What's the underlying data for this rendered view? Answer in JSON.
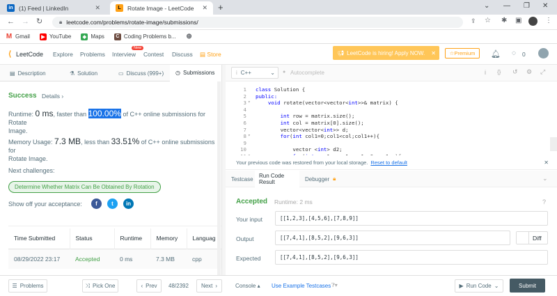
{
  "browser": {
    "tabs": [
      {
        "title": "(1) Feed | LinkedIn",
        "favicon": "in"
      },
      {
        "title": "Rotate Image - LeetCode",
        "favicon": "L"
      }
    ],
    "url": "leetcode.com/problems/rotate-image/submissions/",
    "bookmarks": [
      "Gmail",
      "YouTube",
      "Maps",
      "Coding Problems b..."
    ]
  },
  "nav": {
    "logo": "LeetCode",
    "links": [
      "Explore",
      "Problems",
      "Interview",
      "Contest",
      "Discuss",
      "Store"
    ],
    "new_badge": "New",
    "banner": "LeetCode is hiring! Apply NOW.",
    "premium": "Premium",
    "coins": "0"
  },
  "left_tabs": [
    "Description",
    "Solution",
    "Discuss (999+)",
    "Submissions"
  ],
  "result": {
    "status": "Success",
    "details": "Details",
    "runtime_label": "Runtime:",
    "runtime_value": "0 ms",
    "runtime_faster": ", faster than ",
    "runtime_pct": "100.00%",
    "runtime_rest": " of C++ online submissions for Rotate",
    "runtime_rest2": "Image.",
    "memory_label": "Memory Usage:",
    "memory_value": "7.3 MB",
    "memory_less": ", less than ",
    "memory_pct": "33.51%",
    "memory_rest": " of C++ online submissions for",
    "memory_rest2": "Rotate Image.",
    "next_label": "Next challenges:",
    "next_challenge": "Determine Whether Matrix Can Be Obtained By Rotation",
    "share_label": "Show off your acceptance:"
  },
  "submissions": {
    "headers": [
      "Time Submitted",
      "Status",
      "Runtime",
      "Memory",
      "Languag"
    ],
    "rows": [
      {
        "time": "08/29/2022 23:17",
        "status": "Accepted",
        "runtime": "0 ms",
        "memory": "7.3 MB",
        "lang": "cpp"
      }
    ]
  },
  "editor": {
    "language": "C++",
    "autocomplete": "Autocomplete",
    "line_numbers": [
      "1",
      "2",
      "3",
      "4",
      "5",
      "6",
      "7",
      "8",
      "9",
      "10",
      "11"
    ],
    "lines": [
      "class Solution {",
      "public:",
      "    void rotate(vector<vector<int>>& matrix) {",
      "",
      "        int row = matrix.size();",
      "        int col = matrix[0].size();",
      "        vector<vector<int>> d;",
      "        for(int col1=0;col1<col;col1++){",
      "",
      "            vector <int> d2;",
      "            for(int row1=row-1;row1>=0;row1--){"
    ]
  },
  "console": {
    "restored_msg": "Your previous code was restored from your local storage.",
    "reset_link": "Reset to default",
    "tabs": [
      "Testcase",
      "Run Code Result",
      "Debugger"
    ],
    "status": "Accepted",
    "runtime": "Runtime: 2 ms",
    "your_input_label": "Your input",
    "your_input": "[[1,2,3],[4,5,6],[7,8,9]]",
    "output_label": "Output",
    "output": "[[7,4,1],[8,5,2],[9,6,3]]",
    "diff": "Diff",
    "expected_label": "Expected",
    "expected": "[[7,4,1],[8,5,2],[9,6,3]]"
  },
  "bottom": {
    "problems": "Problems",
    "pick_one": "Pick One",
    "prev": "Prev",
    "page": "48/2392",
    "next": "Next",
    "console": "Console",
    "example_testcases": "Use Example Testcases",
    "run_code": "Run Code",
    "submit": "Submit"
  },
  "colors": {
    "success": "#43a047",
    "accent": "#ffa116",
    "highlight": "#1a73e8"
  }
}
